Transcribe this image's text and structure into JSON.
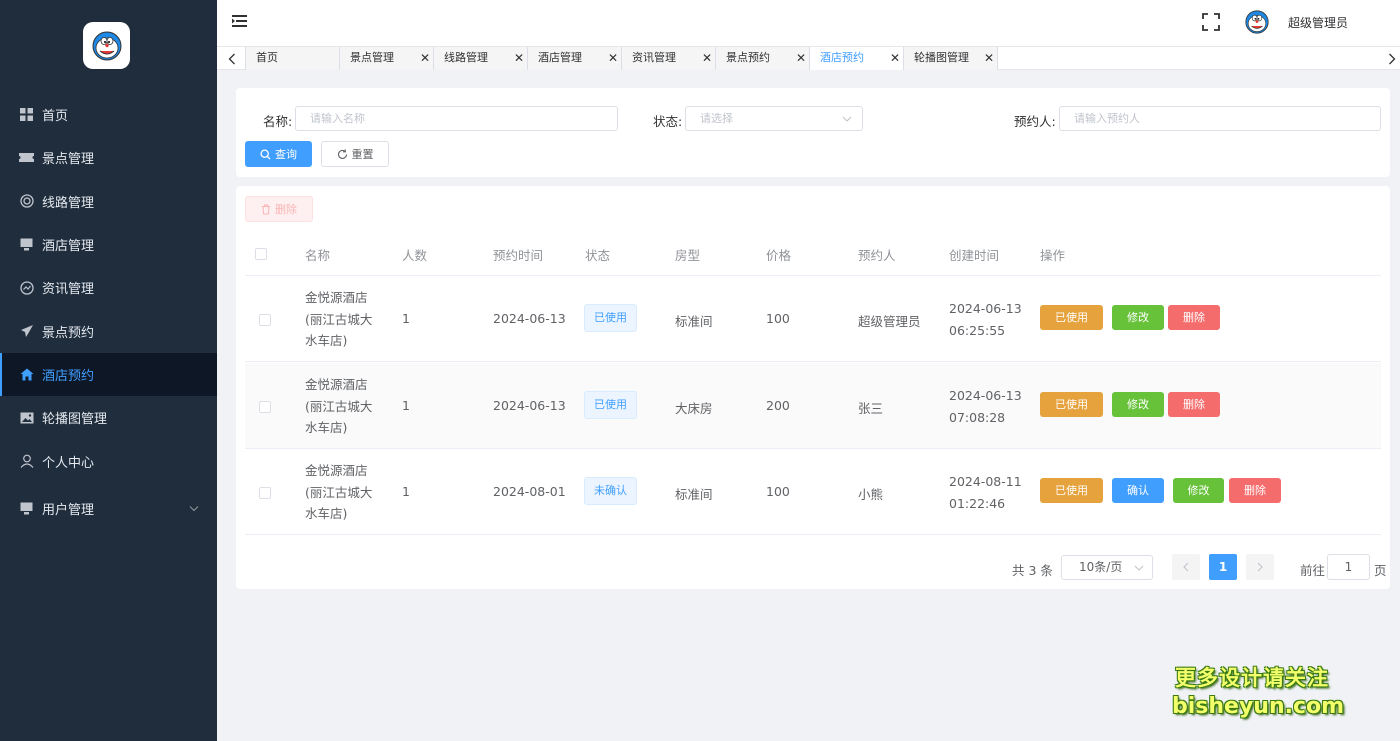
{
  "sidebar": {
    "items": [
      {
        "label": "首页",
        "icon": "grid-icon"
      },
      {
        "label": "景点管理",
        "icon": "ticket-icon"
      },
      {
        "label": "线路管理",
        "icon": "lifebuoy-icon"
      },
      {
        "label": "酒店管理",
        "icon": "monitor-icon"
      },
      {
        "label": "资讯管理",
        "icon": "chart-circle-icon"
      },
      {
        "label": "景点预约",
        "icon": "paper-plane-icon"
      },
      {
        "label": "酒店预约",
        "icon": "home-icon",
        "active": true
      },
      {
        "label": "轮播图管理",
        "icon": "picture-icon"
      },
      {
        "label": "个人中心",
        "icon": "user-icon"
      },
      {
        "label": "用户管理",
        "icon": "monitor-icon",
        "has_submenu": true
      }
    ]
  },
  "header": {
    "username": "超级管理员"
  },
  "tabs": [
    {
      "label": "首页",
      "closable": false
    },
    {
      "label": "景点管理",
      "closable": true
    },
    {
      "label": "线路管理",
      "closable": true
    },
    {
      "label": "酒店管理",
      "closable": true
    },
    {
      "label": "资讯管理",
      "closable": true
    },
    {
      "label": "景点预约",
      "closable": true
    },
    {
      "label": "酒店预约",
      "closable": true,
      "active": true
    },
    {
      "label": "轮播图管理",
      "closable": true
    }
  ],
  "search": {
    "name_label": "名称",
    "name_placeholder": "请输入名称",
    "status_label": "状态",
    "status_placeholder": "请选择",
    "booker_label": "预约人",
    "booker_placeholder": "请输入预约人",
    "query_label": "查询",
    "reset_label": "重置"
  },
  "toolbar": {
    "delete_label": "删除"
  },
  "table": {
    "columns": [
      "名称",
      "人数",
      "预约时间",
      "状态",
      "房型",
      "价格",
      "预约人",
      "创建时间",
      "操作"
    ],
    "rows": [
      {
        "name": [
          "金悦源酒店",
          "(丽江古城大",
          "水车店)"
        ],
        "people": "1",
        "book_date": "2024-06-13",
        "status": "已使用",
        "room_type": "标准间",
        "price": "100",
        "booker": "超级管理员",
        "created": [
          "2024-06-13",
          "06:25:55"
        ],
        "actions": [
          "已使用",
          "修改",
          "删除"
        ]
      },
      {
        "name": [
          "金悦源酒店",
          "(丽江古城大",
          "水车店)"
        ],
        "people": "1",
        "book_date": "2024-06-13",
        "status": "已使用",
        "room_type": "大床房",
        "price": "200",
        "booker": "张三",
        "created": [
          "2024-06-13",
          "07:08:28"
        ],
        "actions": [
          "已使用",
          "修改",
          "删除"
        ]
      },
      {
        "name": [
          "金悦源酒店",
          "(丽江古城大",
          "水车店)"
        ],
        "people": "1",
        "book_date": "2024-08-01",
        "status": "未确认",
        "room_type": "标准间",
        "price": "100",
        "booker": "小熊",
        "created": [
          "2024-08-11",
          "01:22:46"
        ],
        "actions": [
          "已使用",
          "确认",
          "修改",
          "删除"
        ]
      }
    ]
  },
  "pagination": {
    "total": "共 3 条",
    "page_size": "10条/页",
    "current": "1",
    "goto_label": "前往",
    "goto_value": "1",
    "page_suffix": "页"
  },
  "watermark": {
    "line1": "更多设计请关注",
    "line2": "bisheyun.com"
  },
  "colors": {
    "sidebar_bg": "#1f2d3d",
    "primary": "#409eff",
    "warning": "#e6a23c",
    "success": "#67c23a",
    "danger": "#f56c6c"
  }
}
